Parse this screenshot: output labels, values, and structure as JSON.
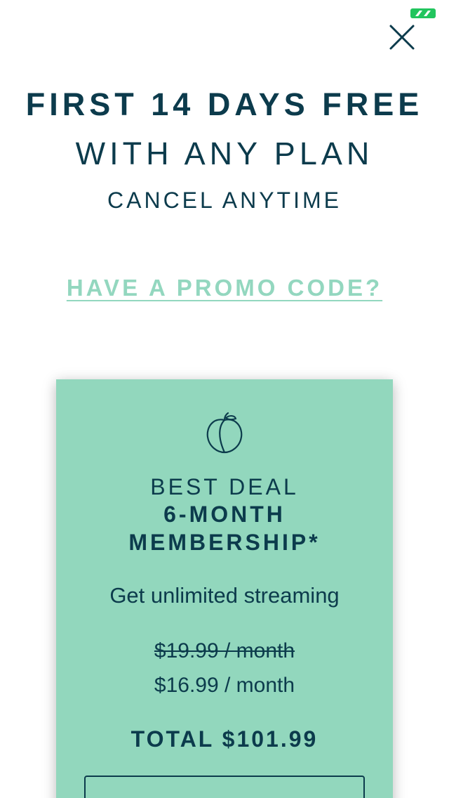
{
  "status": {
    "indicator_icon": "green-flag-icon",
    "color": "#22c55e"
  },
  "header": {
    "close_icon": "close-icon",
    "headline": "FIRST 14 DAYS FREE",
    "subheadline": "WITH ANY PLAN",
    "cancel_note": "CANCEL ANYTIME"
  },
  "promo": {
    "link_label": "HAVE A PROMO CODE?"
  },
  "plan": {
    "icon": "peach-icon",
    "tag": "BEST DEAL",
    "name_line1": "6-MONTH",
    "name_line2": "MEMBERSHIP*",
    "description": "Get unlimited streaming",
    "original_price": "$19.99 / month",
    "price": "$16.99 / month",
    "total": "TOTAL $101.99"
  },
  "colors": {
    "brand_dark": "#0c3b4c",
    "accent_mint": "#93d7bf",
    "card_background": "#92d7bd"
  }
}
